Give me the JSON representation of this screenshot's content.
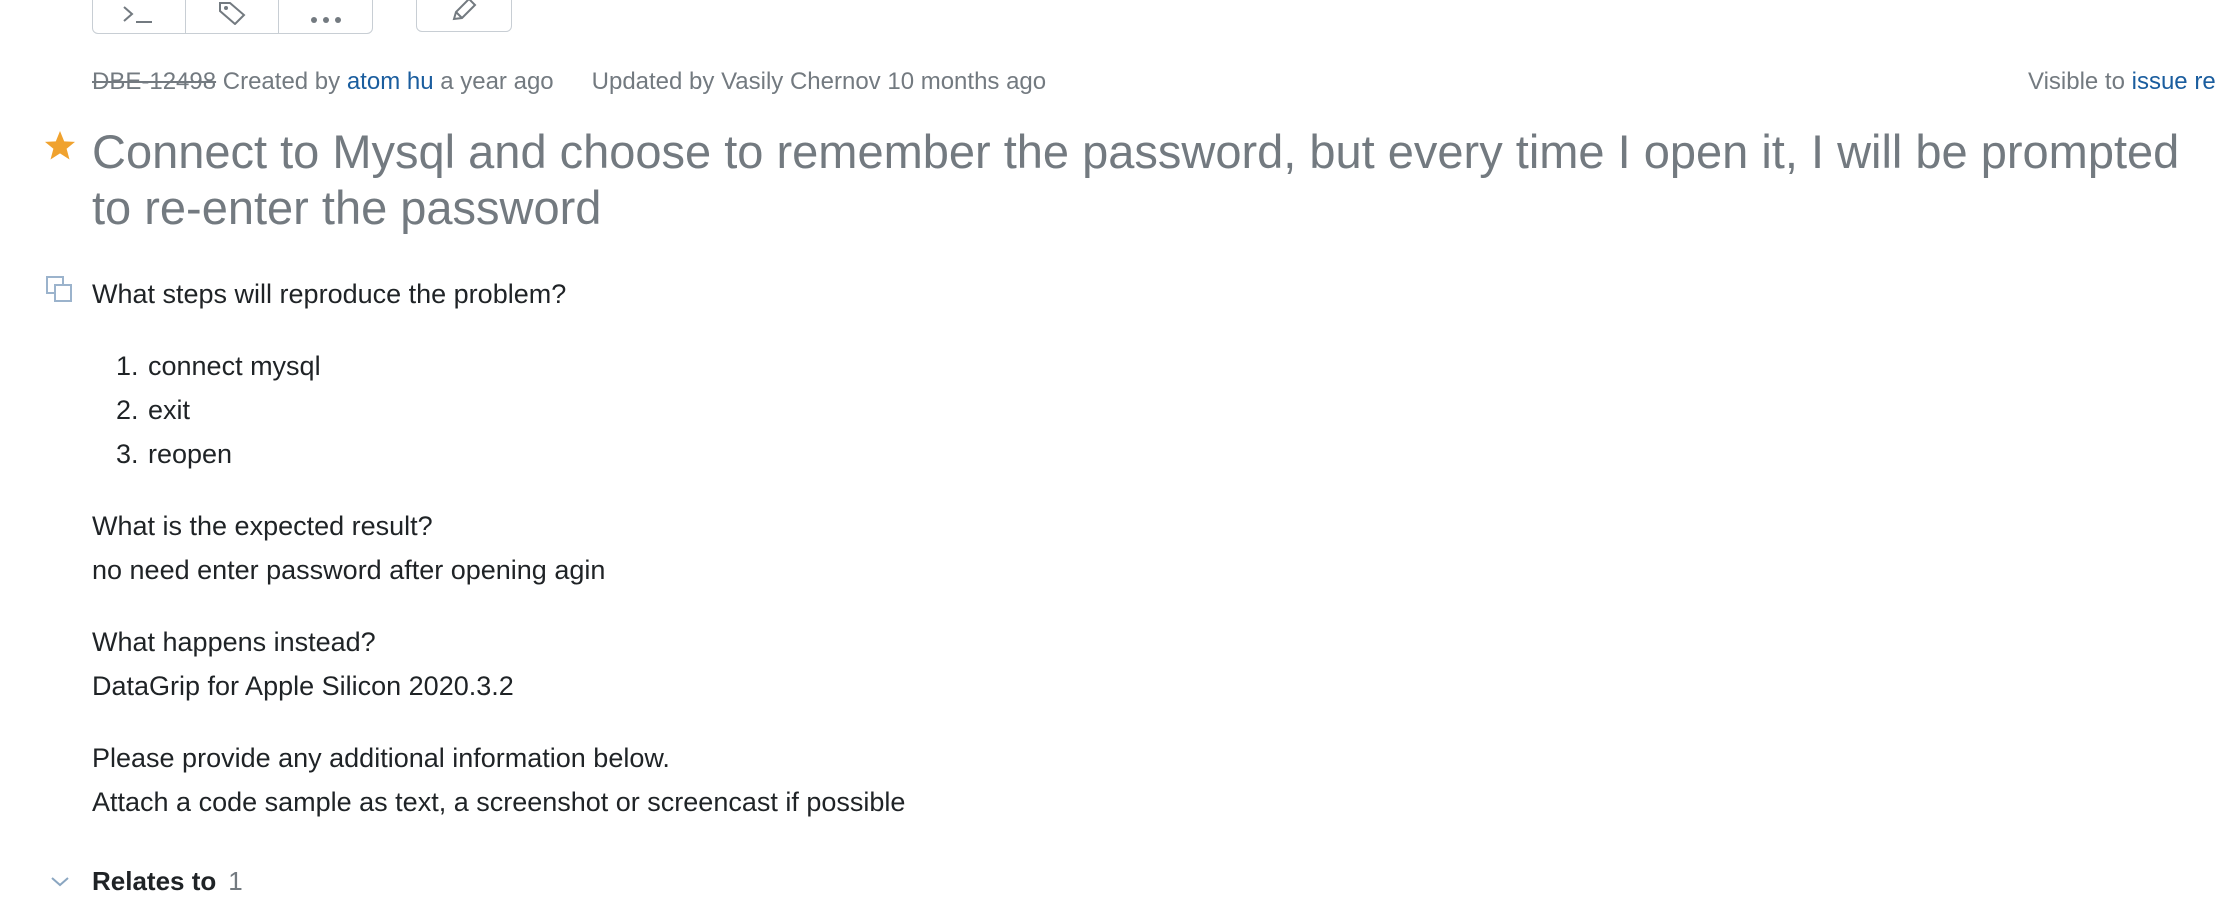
{
  "meta": {
    "issue_id": "DBE-12498",
    "created_prefix": "Created by",
    "creator": "atom hu",
    "created_ago": "a year ago",
    "updated_text": "Updated by Vasily Chernov 10 months ago",
    "visible_prefix": "Visible to",
    "visible_group": "issue re"
  },
  "title": "Connect to Mysql and choose to remember the password, but every time I open it, I will be prompted to re-enter the password",
  "description": {
    "q1": "What steps will reproduce the problem?",
    "steps": [
      {
        "num": "1.",
        "text": "connect mysql"
      },
      {
        "num": "2.",
        "text": "exit"
      },
      {
        "num": "3.",
        "text": "reopen"
      }
    ],
    "q2": "What is the expected result?",
    "a2": "no need enter password after opening agin",
    "q3": "What happens instead?",
    "a3": "DataGrip for Apple Silicon 2020.3.2",
    "q4": "Please provide any additional information below.",
    "a4": "Attach a code sample as text, a screenshot or screencast if possible"
  },
  "relates": {
    "label": "Relates to",
    "count": "1"
  },
  "toolbar": {
    "icons": [
      "terminal-icon",
      "tag-icon",
      "more-icon",
      "edit-icon"
    ]
  },
  "colors": {
    "star": "#f0a22e",
    "link": "#1a5d9e",
    "muted": "#737a80"
  }
}
